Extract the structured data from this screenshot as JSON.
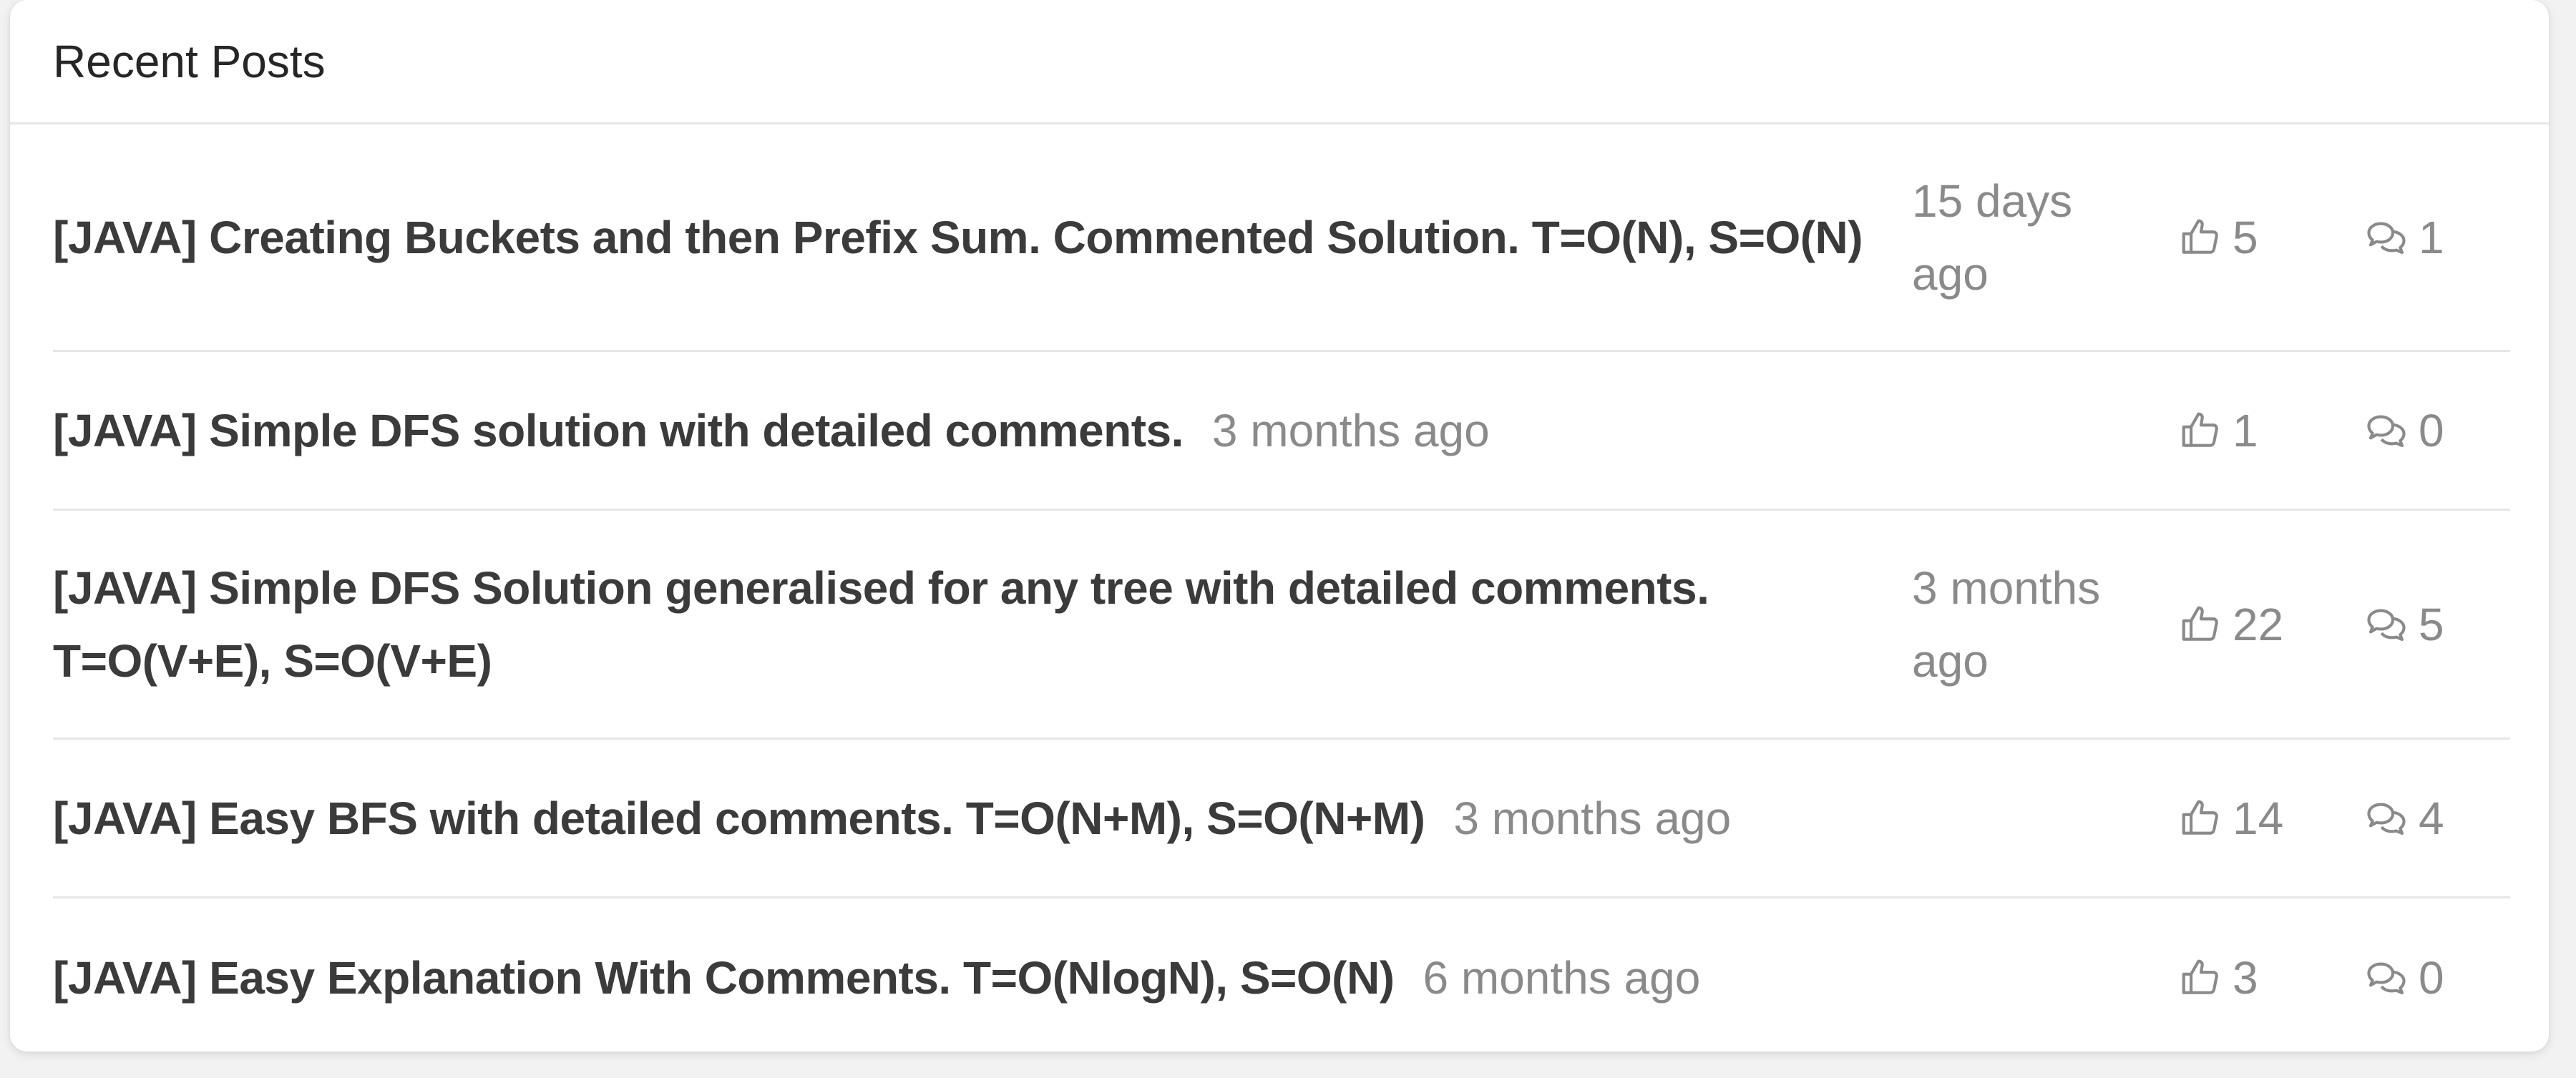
{
  "panel": {
    "title": "Recent Posts"
  },
  "posts": [
    {
      "title": "[JAVA] Creating Buckets and then Prefix Sum. Commented Solution. T=O(N), S=O(N)",
      "time": "15 days ago",
      "votes": "5",
      "comments": "1"
    },
    {
      "title": "[JAVA] Simple DFS solution with detailed comments.",
      "time": "3 months ago",
      "votes": "1",
      "comments": "0"
    },
    {
      "title": "[JAVA] Simple DFS Solution generalised for any tree with detailed comments. T=O(V+E), S=O(V+E)",
      "time": "3 months ago",
      "votes": "22",
      "comments": "5"
    },
    {
      "title": "[JAVA] Easy BFS with detailed comments. T=O(N+M), S=O(N+M)",
      "time": "3 months ago",
      "votes": "14",
      "comments": "4"
    },
    {
      "title": "[JAVA] Easy Explanation With Comments. T=O(NlogN), S=O(N)",
      "time": "6 months ago",
      "votes": "3",
      "comments": "0"
    }
  ],
  "icons": {
    "vote": "thumbs-up-icon",
    "comment": "chat-bubbles-icon"
  },
  "colors": {
    "title": "#3b3b3b",
    "meta": "#8a8a8a",
    "divider": "#e6e6e6",
    "background": "#ffffff"
  }
}
